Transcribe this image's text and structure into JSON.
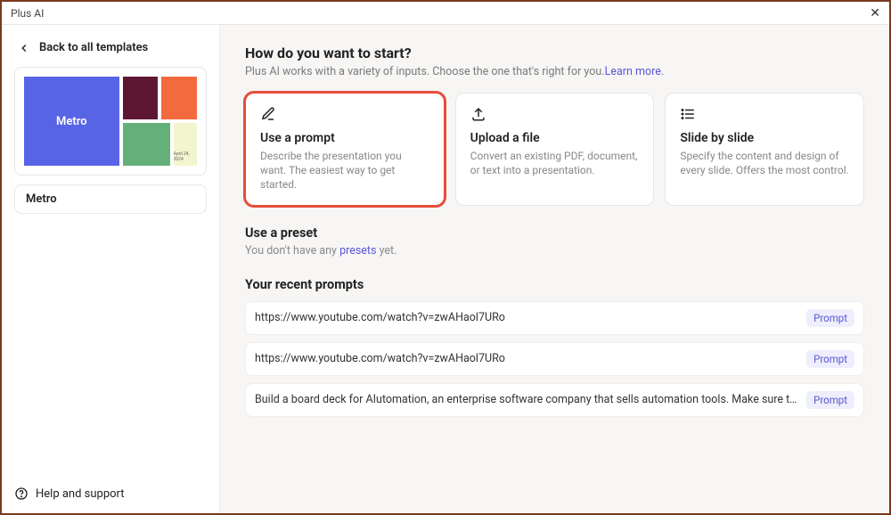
{
  "titlebar": {
    "title": "Plus AI"
  },
  "sidebar": {
    "back_label": "Back to all templates",
    "thumb_label": "Metro",
    "thumb_date": "April 24, 2024",
    "template_name": "Metro",
    "help_label": "Help and support"
  },
  "main": {
    "heading": "How do you want to start?",
    "subheading": "Plus AI works with a variety of inputs. Choose the one that's right for you.",
    "learn_more": "Learn more.",
    "cards": [
      {
        "title": "Use a prompt",
        "desc": "Describe the presentation you want. The easiest way to get started."
      },
      {
        "title": "Upload a file",
        "desc": "Convert an existing PDF, document, or text into a presentation."
      },
      {
        "title": "Slide by slide",
        "desc": "Specify the content and design of every slide. Offers the most control."
      }
    ],
    "preset": {
      "title": "Use a preset",
      "empty_pre": "You don't have any ",
      "link_text": "presets",
      "empty_post": " yet."
    },
    "recent": {
      "title": "Your recent prompts",
      "items": [
        {
          "text": "https://www.youtube.com/watch?v=zwAHaol7URo",
          "badge": "Prompt"
        },
        {
          "text": "https://www.youtube.com/watch?v=zwAHaol7URo",
          "badge": "Prompt"
        },
        {
          "text": "Build a board deck for AIutomation, an enterprise software company that sells automation tools. Make sure to start with a C…",
          "badge": "Prompt"
        }
      ]
    }
  }
}
